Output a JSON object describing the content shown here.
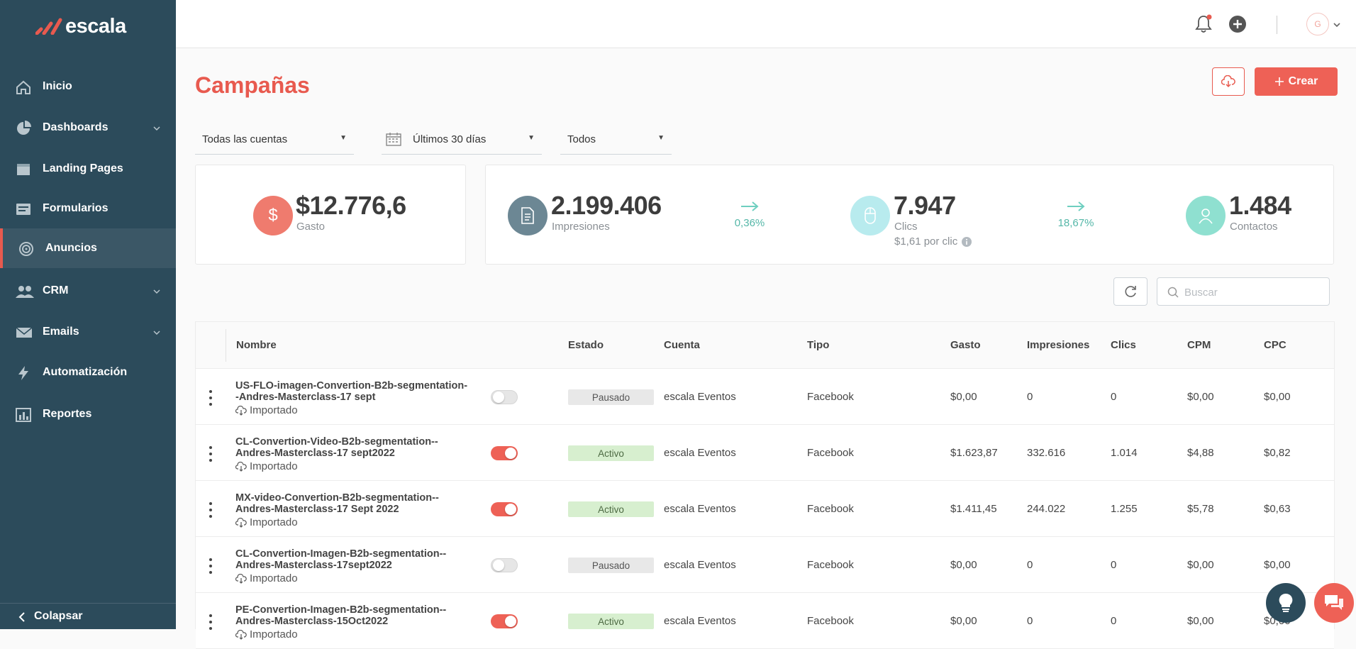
{
  "brand": {
    "name": "escala"
  },
  "sidebar": {
    "items": [
      {
        "label": "Inicio",
        "icon": "home-icon",
        "has_children": false,
        "active": false
      },
      {
        "label": "Dashboards",
        "icon": "pie-chart-icon",
        "has_children": true,
        "active": false
      },
      {
        "label": "Landing Pages",
        "icon": "window-icon",
        "has_children": false,
        "active": false
      },
      {
        "label": "Formularios",
        "icon": "form-icon",
        "has_children": false,
        "active": false
      },
      {
        "label": "Anuncios",
        "icon": "target-icon",
        "has_children": false,
        "active": true
      },
      {
        "label": "CRM",
        "icon": "users-icon",
        "has_children": true,
        "active": false
      },
      {
        "label": "Emails",
        "icon": "mail-icon",
        "has_children": true,
        "active": false
      },
      {
        "label": "Automatización",
        "icon": "bolt-icon",
        "has_children": false,
        "active": false
      },
      {
        "label": "Reportes",
        "icon": "bar-chart-icon",
        "has_children": false,
        "active": false
      }
    ],
    "collapse_label": "Colapsar"
  },
  "topbar": {
    "avatar_initial": "G",
    "notification_dot": true
  },
  "page": {
    "title": "Campañas",
    "create_label": "Crear"
  },
  "filters": {
    "account": "Todas las cuentas",
    "date_range": "Últimos 30 días",
    "status": "Todos"
  },
  "kpis": {
    "spend": {
      "value": "$12.776,6",
      "label": "Gasto",
      "icon": "dollar-icon",
      "color": "#ef7b6e"
    },
    "impressions": {
      "value": "2.199.406",
      "label": "Impresiones",
      "icon": "document-icon",
      "color": "#6c8794"
    },
    "ctr": "0,36%",
    "clicks": {
      "value": "7.947",
      "label": "Clics",
      "sub": "$1,61 por clic",
      "icon": "mouse-icon",
      "color": "#b8ebee"
    },
    "conv_rate": "18,67%",
    "contacts": {
      "value": "1.484",
      "label": "Contactos",
      "icon": "user-icon",
      "color": "#8fe0d0"
    }
  },
  "search": {
    "placeholder": "Buscar"
  },
  "table": {
    "headers": {
      "name": "Nombre",
      "status": "Estado",
      "account": "Cuenta",
      "type": "Tipo",
      "spend": "Gasto",
      "impressions": "Impresiones",
      "clicks": "Clics",
      "cpm": "CPM",
      "cpc": "CPC"
    },
    "rows": [
      {
        "name": "US-FLO-imagen-Convertion-B2b-segmentation--Andres-Masterclass-17 sept",
        "source": "Importado",
        "enabled": false,
        "status": "Pausado",
        "account": "escala Eventos",
        "type": "Facebook",
        "spend": "$0,00",
        "impressions": "0",
        "clicks": "0",
        "cpm": "$0,00",
        "cpc": "$0,00"
      },
      {
        "name": "CL-Convertion-Video-B2b-segmentation--Andres-Masterclass-17 sept2022",
        "source": "Importado",
        "enabled": true,
        "status": "Activo",
        "account": "escala Eventos",
        "type": "Facebook",
        "spend": "$1.623,87",
        "impressions": "332.616",
        "clicks": "1.014",
        "cpm": "$4,88",
        "cpc": "$0,82"
      },
      {
        "name": "MX-video-Convertion-B2b-segmentation--Andres-Masterclass-17 Sept 2022",
        "source": "Importado",
        "enabled": true,
        "status": "Activo",
        "account": "escala Eventos",
        "type": "Facebook",
        "spend": "$1.411,45",
        "impressions": "244.022",
        "clicks": "1.255",
        "cpm": "$5,78",
        "cpc": "$0,63"
      },
      {
        "name": "CL-Convertion-Imagen-B2b-segmentation--Andres-Masterclass-17sept2022",
        "source": "Importado",
        "enabled": false,
        "status": "Pausado",
        "account": "escala Eventos",
        "type": "Facebook",
        "spend": "$0,00",
        "impressions": "0",
        "clicks": "0",
        "cpm": "$0,00",
        "cpc": "$0,00"
      },
      {
        "name": "PE-Convertion-Imagen-B2b-segmentation--Andres-Masterclass-15Oct2022",
        "source": "Importado",
        "enabled": true,
        "status": "Activo",
        "account": "escala Eventos",
        "type": "Facebook",
        "spend": "$0,00",
        "impressions": "0",
        "clicks": "0",
        "cpm": "$0,00",
        "cpc": "$0,00"
      }
    ]
  }
}
